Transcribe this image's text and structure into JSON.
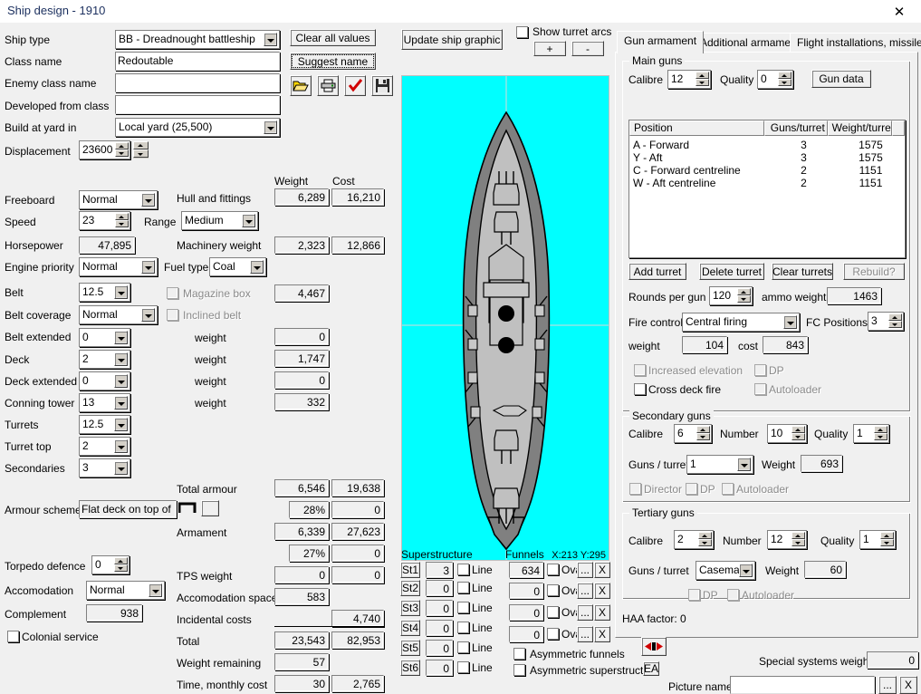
{
  "window": {
    "title": "Ship design - 1910",
    "close_icon": "close-icon"
  },
  "left_panel": {
    "ship_type": {
      "label": "Ship type",
      "value": "BB - Dreadnought battleship"
    },
    "class_name": {
      "label": "Class name",
      "value": "Redoutable"
    },
    "enemy_class_name": {
      "label": "Enemy class name",
      "value": ""
    },
    "developed_from_class": {
      "label": "Developed from class",
      "value": ""
    },
    "build_at_yard": {
      "label": "Build at yard in",
      "value": "Local yard (25,500)"
    },
    "displacement": {
      "label": "Displacement",
      "value": "23600"
    },
    "freeboard": {
      "label": "Freeboard",
      "value": "Normal"
    },
    "speed": {
      "label": "Speed",
      "value": "23"
    },
    "range": {
      "label": "Range",
      "value": "Medium"
    },
    "horsepower": {
      "label": "Horsepower",
      "value": "47,895"
    },
    "engine_priority": {
      "label": "Engine priority",
      "value": "Normal"
    },
    "fuel_type": {
      "label": "Fuel type",
      "value": "Coal"
    },
    "belt": {
      "label": "Belt",
      "value": "12.5"
    },
    "magazine_box": {
      "label": "Magazine box",
      "checked": false,
      "disabled": true
    },
    "belt_coverage": {
      "label": "Belt coverage",
      "value": "Normal"
    },
    "inclined_belt": {
      "label": "Inclined belt",
      "checked": false,
      "disabled": true
    },
    "belt_extended": {
      "label": "Belt extended",
      "value": "0"
    },
    "deck": {
      "label": "Deck",
      "value": "2"
    },
    "deck_extended": {
      "label": "Deck extended",
      "value": "0"
    },
    "conning_tower": {
      "label": "Conning tower",
      "value": "13"
    },
    "turrets": {
      "label": "Turrets",
      "value": "12.5"
    },
    "turret_top": {
      "label": "Turret top",
      "value": "2"
    },
    "secondaries": {
      "label": "Secondaries",
      "value": "3"
    },
    "armour_scheme": {
      "label": "Armour scheme",
      "value": "Flat deck on top of"
    },
    "torpedo_defence": {
      "label": "Torpedo defence",
      "value": "0"
    },
    "accomodation": {
      "label": "Accomodation",
      "value": "Normal"
    },
    "complement": {
      "label": "Complement",
      "value": "938"
    },
    "colonial_service": {
      "label": "Colonial service",
      "checked": false
    },
    "weight_label_small_1": "weight",
    "weight_label_small_2": "weight",
    "weight_label_small_3": "weight",
    "weight_label_small_4": "weight"
  },
  "weights": {
    "col_weight": "Weight",
    "col_cost": "Cost",
    "rows": [
      {
        "label": "Hull and fittings",
        "weight": "6,289",
        "cost": "16,210"
      },
      {
        "label": "Machinery weight",
        "weight": "2,323",
        "cost": "12,866"
      },
      {
        "label": "Total armour",
        "weight": "6,546",
        "cost": "19,638"
      },
      {
        "label": "Armament",
        "weight": "6,339",
        "cost": "27,623"
      },
      {
        "label": "TPS weight",
        "weight": "0",
        "cost": "0"
      },
      {
        "label": "Accomodation space",
        "weight": "583",
        "cost": ""
      },
      {
        "label": "Incidental costs",
        "weight": "",
        "cost": "4,740"
      },
      {
        "label": "Total",
        "weight": "23,543",
        "cost": "82,953"
      },
      {
        "label": "Weight remaining",
        "weight": "57",
        "cost": ""
      },
      {
        "label": "Time, monthly cost",
        "weight": "30",
        "cost": "2,765"
      }
    ],
    "magazine_weight": "4,467",
    "belt_ext_weight": "0",
    "deck_weight": "1,747",
    "deck_ext_weight": "0",
    "ct_weight": "332",
    "armour_pct": "28%",
    "armour_pct_cost": "0",
    "armament_pct": "27%",
    "armament_pct_cost": "0"
  },
  "toolbar": {
    "clear_all": "Clear all values",
    "suggest_name": "Suggest name",
    "open_icon": "folder-open-icon",
    "print_icon": "printer-icon",
    "check_icon": "checkmark-icon",
    "save_icon": "floppy-disk-icon",
    "update_graphic": "Update ship graphic",
    "show_turret_arcs": "Show turret arcs",
    "show_turret_arcs_checked": false,
    "plus": "+",
    "minus": "-"
  },
  "ship_graphic": {
    "coords": "X:213 Y:295",
    "sea_color": "#00ffff",
    "hull_dark": "#808080",
    "hull_light": "#c0c0c0"
  },
  "bottom": {
    "superstructure_label": "Superstructure",
    "funnels_label": "Funnels",
    "line_label": "Line",
    "oval_label": "Oval",
    "asym_funnels": "Asymmetric funnels",
    "asym_superstructure": "Asymmetric superstructure",
    "superstructure_rows": [
      {
        "btn": "St1",
        "value": "3"
      },
      {
        "btn": "St2",
        "value": "0"
      },
      {
        "btn": "St3",
        "value": "0"
      },
      {
        "btn": "St4",
        "value": "0"
      },
      {
        "btn": "St5",
        "value": "0"
      },
      {
        "btn": "St6",
        "value": "0"
      }
    ],
    "funnel_rows": [
      {
        "value": "634"
      },
      {
        "value": "0"
      },
      {
        "value": "0"
      },
      {
        "value": "0"
      }
    ],
    "ellipsis": "...",
    "delete_x": "X"
  },
  "right_panel": {
    "tabs": [
      {
        "label": "Gun armament",
        "active": true
      },
      {
        "label": "Additional armament",
        "active": false
      },
      {
        "label": "Flight installations, missiles",
        "active": false
      }
    ],
    "main_guns": {
      "title": "Main guns",
      "calibre_label": "Calibre",
      "calibre": "12",
      "quality_label": "Quality",
      "quality": "0",
      "gun_data_button": "Gun data",
      "columns": [
        "Position",
        "Guns/turret",
        "Weight/turret"
      ],
      "rows": [
        {
          "position": "A - Forward",
          "guns": "3",
          "weight": "1575"
        },
        {
          "position": "Y - Aft",
          "guns": "3",
          "weight": "1575"
        },
        {
          "position": "C - Forward centreline",
          "guns": "2",
          "weight": "1151"
        },
        {
          "position": "W - Aft centreline",
          "guns": "2",
          "weight": "1151"
        }
      ],
      "add_turret": "Add turret",
      "delete_turret": "Delete turret",
      "clear_turrets": "Clear turrets",
      "rebuild": "Rebuild?",
      "rounds_per_gun_label": "Rounds per gun",
      "rounds_per_gun": "120",
      "ammo_weight_label": "ammo weight",
      "ammo_weight": "1463",
      "fire_control_label": "Fire control",
      "fire_control": "Central firing",
      "fc_positions_label": "FC Positions",
      "fc_positions": "3",
      "weight_label": "weight",
      "weight": "104",
      "cost_label": "cost",
      "cost": "843",
      "increased_elevation": "Increased elevation",
      "dp": "DP",
      "cross_deck_fire": "Cross deck fire",
      "autoloader": "Autoloader"
    },
    "secondary_guns": {
      "title": "Secondary guns",
      "calibre_label": "Calibre",
      "calibre": "6",
      "number_label": "Number",
      "number": "10",
      "quality_label": "Quality",
      "quality": "1",
      "guns_turret_label": "Guns / turret",
      "guns_turret": "1",
      "weight_label": "Weight",
      "weight": "693",
      "director": "Director",
      "dp": "DP",
      "autoloader": "Autoloader"
    },
    "tertiary_guns": {
      "title": "Tertiary guns",
      "calibre_label": "Calibre",
      "calibre": "2",
      "number_label": "Number",
      "number": "12",
      "quality_label": "Quality",
      "quality": "1",
      "guns_turret_label": "Guns / turret",
      "guns_turret": "Casemate:",
      "weight_label": "Weight",
      "weight": "60",
      "dp": "DP",
      "autoloader": "Autoloader"
    },
    "haa_factor": "HAA factor: 0",
    "arrows_icon": "left-right-arrows-icon",
    "ea_button": "EA",
    "special_systems_weight_label": "Special systems weight",
    "special_systems_weight": "0",
    "picture_name_label": "Picture name",
    "picture_name": "",
    "picture_browse": "...",
    "picture_clear": "X"
  }
}
